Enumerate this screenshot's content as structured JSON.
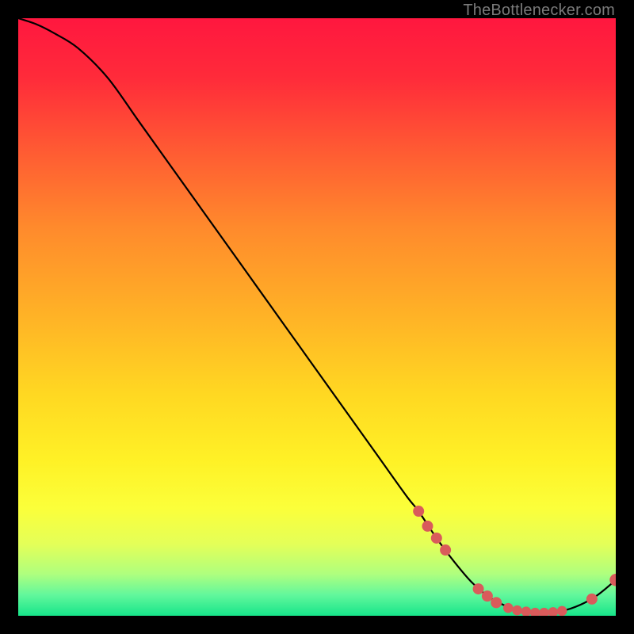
{
  "watermark": "TheBottlenecker.com",
  "chart_data": {
    "type": "line",
    "title": "",
    "xlabel": "",
    "ylabel": "",
    "xlim": [
      0,
      100
    ],
    "ylim": [
      0,
      100
    ],
    "grid": false,
    "series": [
      {
        "name": "bottleneck-curve",
        "x": [
          0,
          3,
          6,
          10,
          15,
          20,
          25,
          30,
          35,
          40,
          45,
          50,
          55,
          60,
          65,
          67,
          70,
          73,
          76,
          79,
          82,
          85,
          88,
          91,
          94,
          97,
          100
        ],
        "y": [
          100,
          99,
          97.5,
          95,
          90,
          83,
          76,
          69,
          62,
          55,
          48,
          41,
          34,
          27,
          20,
          17.5,
          13,
          9,
          5.5,
          3,
          1.5,
          0.8,
          0.5,
          0.8,
          1.8,
          3.5,
          6
        ]
      }
    ],
    "markers": [
      {
        "x": 67,
        "y": 17.5,
        "r": 1.0
      },
      {
        "x": 68.5,
        "y": 15,
        "r": 1.0
      },
      {
        "x": 70,
        "y": 13,
        "r": 1.0
      },
      {
        "x": 71.5,
        "y": 11,
        "r": 1.0
      },
      {
        "x": 77,
        "y": 4.5,
        "r": 1.0
      },
      {
        "x": 78.5,
        "y": 3.3,
        "r": 1.0
      },
      {
        "x": 80,
        "y": 2.2,
        "r": 1.0
      },
      {
        "x": 82,
        "y": 1.3,
        "r": 0.9
      },
      {
        "x": 83.5,
        "y": 0.9,
        "r": 0.9
      },
      {
        "x": 85,
        "y": 0.7,
        "r": 0.9
      },
      {
        "x": 86.5,
        "y": 0.5,
        "r": 0.9
      },
      {
        "x": 88,
        "y": 0.5,
        "r": 0.9
      },
      {
        "x": 89.5,
        "y": 0.6,
        "r": 0.9
      },
      {
        "x": 91,
        "y": 0.8,
        "r": 0.9
      },
      {
        "x": 96,
        "y": 2.8,
        "r": 1.0
      },
      {
        "x": 100,
        "y": 6,
        "r": 1.1
      }
    ],
    "gradient_stops": [
      {
        "offset": 0.0,
        "color": "#ff173f"
      },
      {
        "offset": 0.1,
        "color": "#ff2b3a"
      },
      {
        "offset": 0.22,
        "color": "#ff5a33"
      },
      {
        "offset": 0.35,
        "color": "#ff8a2c"
      },
      {
        "offset": 0.5,
        "color": "#ffb326"
      },
      {
        "offset": 0.63,
        "color": "#ffd822"
      },
      {
        "offset": 0.74,
        "color": "#fff126"
      },
      {
        "offset": 0.82,
        "color": "#fbff3a"
      },
      {
        "offset": 0.88,
        "color": "#e4ff58"
      },
      {
        "offset": 0.93,
        "color": "#afff7e"
      },
      {
        "offset": 0.965,
        "color": "#62f79c"
      },
      {
        "offset": 1.0,
        "color": "#17e58a"
      }
    ],
    "marker_color": "#d95b5b",
    "curve_color": "#000000"
  }
}
